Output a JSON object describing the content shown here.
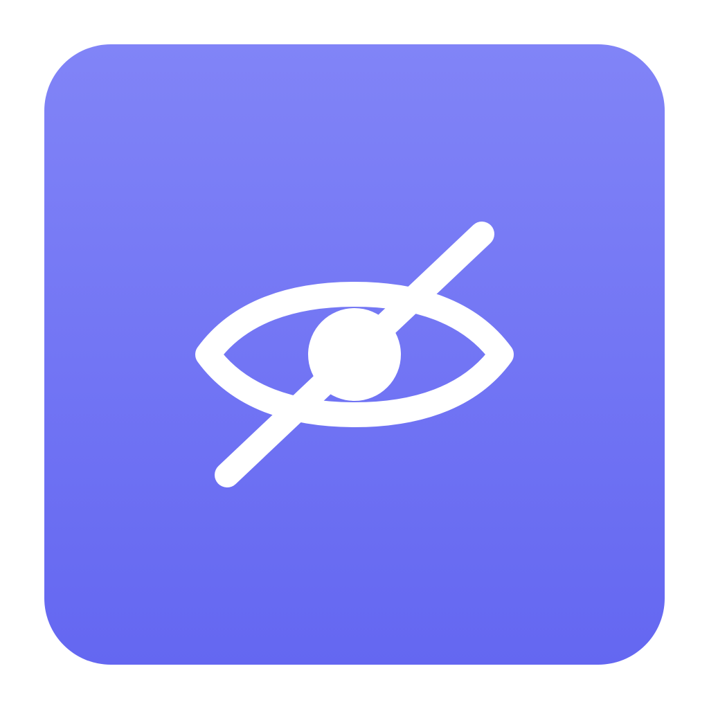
{
  "icon": {
    "name": "eye-off-icon",
    "background_top": "#8184f7",
    "background_bottom": "#6467f1",
    "glyph_color": "#ffffff"
  }
}
